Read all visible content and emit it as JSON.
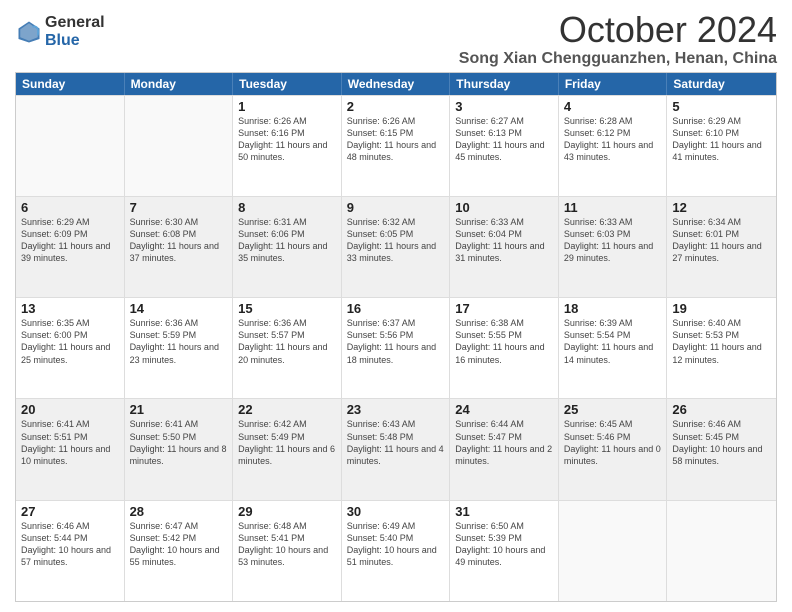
{
  "logo": {
    "general": "General",
    "blue": "Blue"
  },
  "title": "October 2024",
  "subtitle": "Song Xian Chengguanzhen, Henan, China",
  "header_days": [
    "Sunday",
    "Monday",
    "Tuesday",
    "Wednesday",
    "Thursday",
    "Friday",
    "Saturday"
  ],
  "weeks": [
    [
      {
        "day": "",
        "sunrise": "",
        "sunset": "",
        "daylight": "",
        "empty": true
      },
      {
        "day": "",
        "sunrise": "",
        "sunset": "",
        "daylight": "",
        "empty": true
      },
      {
        "day": "1",
        "sunrise": "Sunrise: 6:26 AM",
        "sunset": "Sunset: 6:16 PM",
        "daylight": "Daylight: 11 hours and 50 minutes."
      },
      {
        "day": "2",
        "sunrise": "Sunrise: 6:26 AM",
        "sunset": "Sunset: 6:15 PM",
        "daylight": "Daylight: 11 hours and 48 minutes."
      },
      {
        "day": "3",
        "sunrise": "Sunrise: 6:27 AM",
        "sunset": "Sunset: 6:13 PM",
        "daylight": "Daylight: 11 hours and 45 minutes."
      },
      {
        "day": "4",
        "sunrise": "Sunrise: 6:28 AM",
        "sunset": "Sunset: 6:12 PM",
        "daylight": "Daylight: 11 hours and 43 minutes."
      },
      {
        "day": "5",
        "sunrise": "Sunrise: 6:29 AM",
        "sunset": "Sunset: 6:10 PM",
        "daylight": "Daylight: 11 hours and 41 minutes."
      }
    ],
    [
      {
        "day": "6",
        "sunrise": "Sunrise: 6:29 AM",
        "sunset": "Sunset: 6:09 PM",
        "daylight": "Daylight: 11 hours and 39 minutes."
      },
      {
        "day": "7",
        "sunrise": "Sunrise: 6:30 AM",
        "sunset": "Sunset: 6:08 PM",
        "daylight": "Daylight: 11 hours and 37 minutes."
      },
      {
        "day": "8",
        "sunrise": "Sunrise: 6:31 AM",
        "sunset": "Sunset: 6:06 PM",
        "daylight": "Daylight: 11 hours and 35 minutes."
      },
      {
        "day": "9",
        "sunrise": "Sunrise: 6:32 AM",
        "sunset": "Sunset: 6:05 PM",
        "daylight": "Daylight: 11 hours and 33 minutes."
      },
      {
        "day": "10",
        "sunrise": "Sunrise: 6:33 AM",
        "sunset": "Sunset: 6:04 PM",
        "daylight": "Daylight: 11 hours and 31 minutes."
      },
      {
        "day": "11",
        "sunrise": "Sunrise: 6:33 AM",
        "sunset": "Sunset: 6:03 PM",
        "daylight": "Daylight: 11 hours and 29 minutes."
      },
      {
        "day": "12",
        "sunrise": "Sunrise: 6:34 AM",
        "sunset": "Sunset: 6:01 PM",
        "daylight": "Daylight: 11 hours and 27 minutes."
      }
    ],
    [
      {
        "day": "13",
        "sunrise": "Sunrise: 6:35 AM",
        "sunset": "Sunset: 6:00 PM",
        "daylight": "Daylight: 11 hours and 25 minutes."
      },
      {
        "day": "14",
        "sunrise": "Sunrise: 6:36 AM",
        "sunset": "Sunset: 5:59 PM",
        "daylight": "Daylight: 11 hours and 23 minutes."
      },
      {
        "day": "15",
        "sunrise": "Sunrise: 6:36 AM",
        "sunset": "Sunset: 5:57 PM",
        "daylight": "Daylight: 11 hours and 20 minutes."
      },
      {
        "day": "16",
        "sunrise": "Sunrise: 6:37 AM",
        "sunset": "Sunset: 5:56 PM",
        "daylight": "Daylight: 11 hours and 18 minutes."
      },
      {
        "day": "17",
        "sunrise": "Sunrise: 6:38 AM",
        "sunset": "Sunset: 5:55 PM",
        "daylight": "Daylight: 11 hours and 16 minutes."
      },
      {
        "day": "18",
        "sunrise": "Sunrise: 6:39 AM",
        "sunset": "Sunset: 5:54 PM",
        "daylight": "Daylight: 11 hours and 14 minutes."
      },
      {
        "day": "19",
        "sunrise": "Sunrise: 6:40 AM",
        "sunset": "Sunset: 5:53 PM",
        "daylight": "Daylight: 11 hours and 12 minutes."
      }
    ],
    [
      {
        "day": "20",
        "sunrise": "Sunrise: 6:41 AM",
        "sunset": "Sunset: 5:51 PM",
        "daylight": "Daylight: 11 hours and 10 minutes."
      },
      {
        "day": "21",
        "sunrise": "Sunrise: 6:41 AM",
        "sunset": "Sunset: 5:50 PM",
        "daylight": "Daylight: 11 hours and 8 minutes."
      },
      {
        "day": "22",
        "sunrise": "Sunrise: 6:42 AM",
        "sunset": "Sunset: 5:49 PM",
        "daylight": "Daylight: 11 hours and 6 minutes."
      },
      {
        "day": "23",
        "sunrise": "Sunrise: 6:43 AM",
        "sunset": "Sunset: 5:48 PM",
        "daylight": "Daylight: 11 hours and 4 minutes."
      },
      {
        "day": "24",
        "sunrise": "Sunrise: 6:44 AM",
        "sunset": "Sunset: 5:47 PM",
        "daylight": "Daylight: 11 hours and 2 minutes."
      },
      {
        "day": "25",
        "sunrise": "Sunrise: 6:45 AM",
        "sunset": "Sunset: 5:46 PM",
        "daylight": "Daylight: 11 hours and 0 minutes."
      },
      {
        "day": "26",
        "sunrise": "Sunrise: 6:46 AM",
        "sunset": "Sunset: 5:45 PM",
        "daylight": "Daylight: 10 hours and 58 minutes."
      }
    ],
    [
      {
        "day": "27",
        "sunrise": "Sunrise: 6:46 AM",
        "sunset": "Sunset: 5:44 PM",
        "daylight": "Daylight: 10 hours and 57 minutes."
      },
      {
        "day": "28",
        "sunrise": "Sunrise: 6:47 AM",
        "sunset": "Sunset: 5:42 PM",
        "daylight": "Daylight: 10 hours and 55 minutes."
      },
      {
        "day": "29",
        "sunrise": "Sunrise: 6:48 AM",
        "sunset": "Sunset: 5:41 PM",
        "daylight": "Daylight: 10 hours and 53 minutes."
      },
      {
        "day": "30",
        "sunrise": "Sunrise: 6:49 AM",
        "sunset": "Sunset: 5:40 PM",
        "daylight": "Daylight: 10 hours and 51 minutes."
      },
      {
        "day": "31",
        "sunrise": "Sunrise: 6:50 AM",
        "sunset": "Sunset: 5:39 PM",
        "daylight": "Daylight: 10 hours and 49 minutes."
      },
      {
        "day": "",
        "sunrise": "",
        "sunset": "",
        "daylight": "",
        "empty": true
      },
      {
        "day": "",
        "sunrise": "",
        "sunset": "",
        "daylight": "",
        "empty": true
      }
    ]
  ]
}
